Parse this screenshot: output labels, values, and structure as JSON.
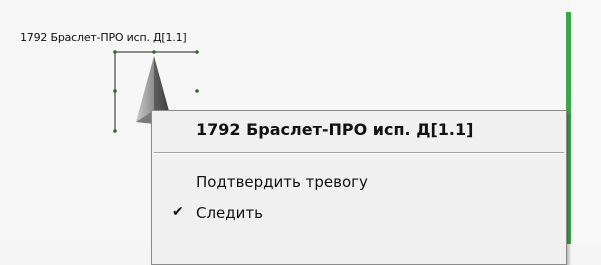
{
  "marker": {
    "label": "1792 Браслет-ПРО исп. Д[1.1]",
    "icon": "arrow-pointer-icon"
  },
  "context_menu": {
    "header": "1792 Браслет-ПРО исп. Д[1.1]",
    "items": [
      {
        "label": "Подтвердить тревогу",
        "checked": false
      },
      {
        "label": "Следить",
        "checked": true
      }
    ]
  },
  "colors": {
    "route_line": "#3aa64a",
    "menu_bg": "#f0f0f0"
  }
}
